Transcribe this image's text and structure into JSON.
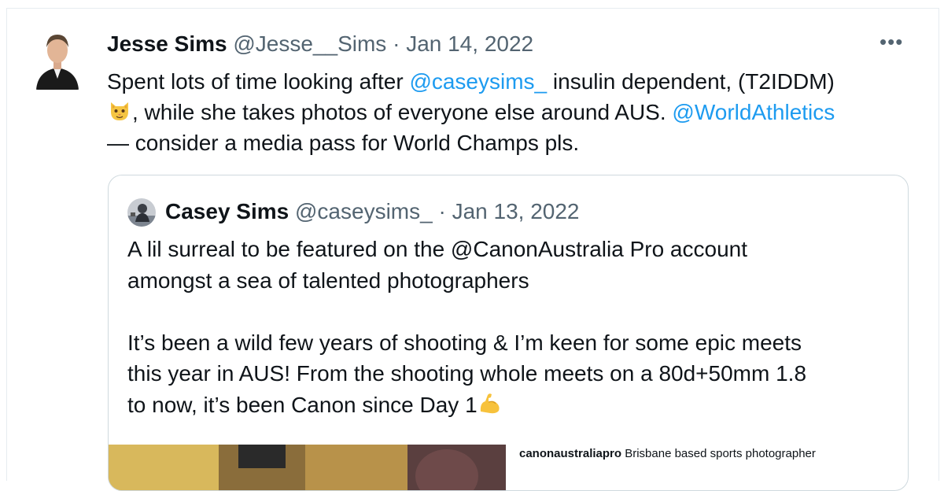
{
  "tweet": {
    "name": "Jesse Sims",
    "handle": "@Jesse__Sims",
    "separator": "·",
    "date": "Jan 14, 2022",
    "more_label": "•••",
    "text": {
      "part1": "Spent lots of time looking after ",
      "mention1": "@caseysims_",
      "part2": " insulin dependent, (T2IDDM)",
      "emoji": "cat-face-emoji",
      "part3": ", while she takes photos of everyone else around AUS. ",
      "mention2": "@WorldAthletics",
      "part4": "— consider a media pass for World Champs pls."
    }
  },
  "quoted": {
    "name": "Casey Sims",
    "handle": "@caseysims_",
    "separator": "·",
    "date": "Jan 13, 2022",
    "line1": "A lil surreal to be featured on the @CanonAustralia Pro account",
    "line2": "amongst a sea of talented photographers",
    "line3": "It’s been a wild few years of shooting & I’m keen for some epic meets",
    "line4": "this year in AUS! From the shooting whole meets on a 80d+50mm 1.8",
    "line5": "to now, it’s been Canon since Day 1",
    "emoji": "flexed-biceps-emoji",
    "media_caption_user": "canonaustraliapro",
    "media_caption_text": " Brisbane based sports photographer"
  },
  "colors": {
    "accent": "#1d9bf0",
    "muted": "#536471",
    "text": "#0f1419",
    "border": "#cfd9de"
  }
}
